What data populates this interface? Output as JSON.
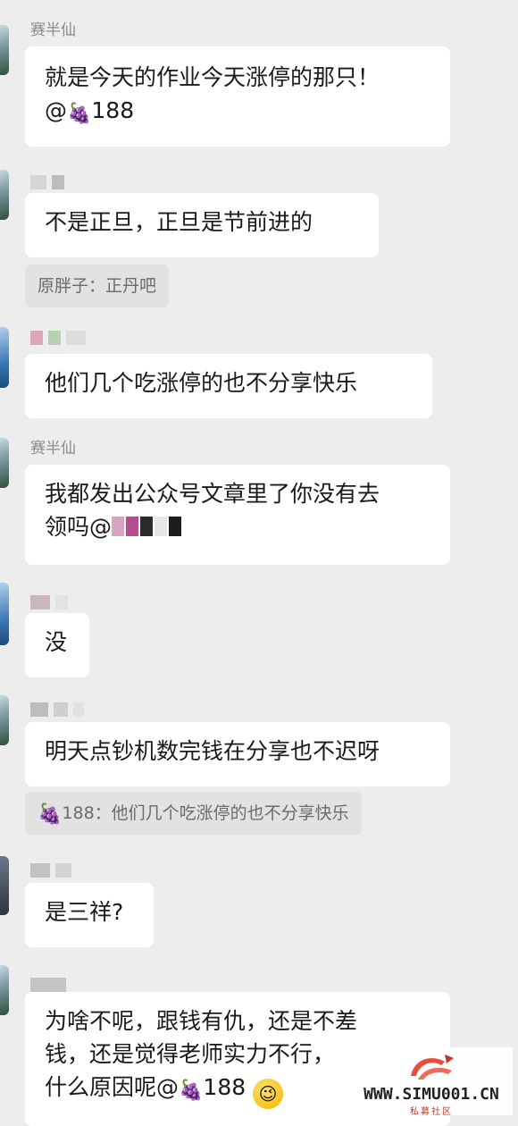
{
  "messages": [
    {
      "sender": "赛半仙",
      "text": "就是今天的作业今天涨停的那只！\n@",
      "mention": "188"
    },
    {
      "text": "不是正旦，正旦是节前进的",
      "quote": "原胖子：正丹吧"
    },
    {
      "text": "他们几个吃涨停的也不分享快乐"
    },
    {
      "sender": "赛半仙",
      "text": "我都发出公众号文章里了你没有去\n领吗@"
    },
    {
      "text": "没"
    },
    {
      "text": "明天点钞机数完钱在分享也不迟呀",
      "quote": "188：他们几个吃涨停的也不分享快乐"
    },
    {
      "text": "是三祥?"
    },
    {
      "text": "为啥不呢，跟钱有仇，还是不差\n钱，还是觉得老师实力不行，\n什么原因呢@",
      "mention": "188"
    }
  ],
  "icons": {
    "grape": "grape-emoji",
    "wink": "wink-face-emoji"
  },
  "watermark": {
    "site": "WWW.SIMU001.CN",
    "subtitle": "私募社区"
  }
}
